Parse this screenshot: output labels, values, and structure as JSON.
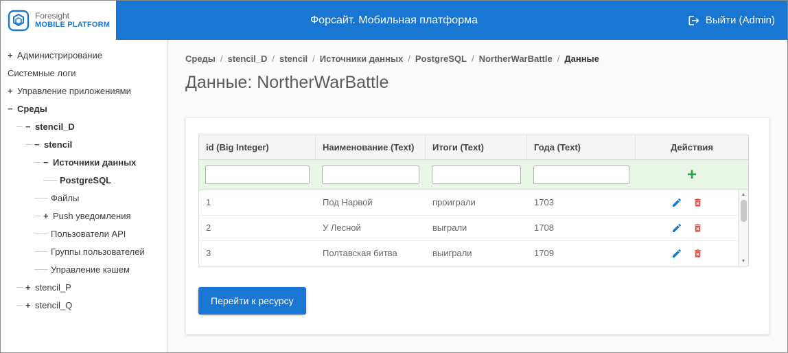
{
  "colors": {
    "primary": "#1976d2",
    "success": "#2f9e44",
    "danger": "#d9534f"
  },
  "header": {
    "logo_title": "Foresight",
    "logo_subtitle": "MOBILE PLATFORM",
    "app_title": "Форсайт. Мобильная платформа",
    "logout_label": "Выйти (Admin)"
  },
  "sidebar": {
    "items": [
      {
        "label": "Администрирование",
        "expander": "+",
        "level": 0,
        "bold": false
      },
      {
        "label": "Системные логи",
        "expander": "",
        "level": 0,
        "bold": false
      },
      {
        "label": "Управление приложениями",
        "expander": "+",
        "level": 0,
        "bold": false
      },
      {
        "label": "Среды",
        "expander": "−",
        "level": 0,
        "bold": true
      },
      {
        "label": "stencil_D",
        "expander": "−",
        "level": 1,
        "bold": true
      },
      {
        "label": "stencil",
        "expander": "−",
        "level": 2,
        "bold": true
      },
      {
        "label": "Источники данных",
        "expander": "−",
        "level": 3,
        "bold": true
      },
      {
        "label": "PostgreSQL",
        "expander": "",
        "level": 4,
        "bold": true
      },
      {
        "label": "Файлы",
        "expander": "",
        "level": 3,
        "bold": false
      },
      {
        "label": "Push уведомления",
        "expander": "+",
        "level": 3,
        "bold": false
      },
      {
        "label": "Пользователи API",
        "expander": "",
        "level": 3,
        "bold": false
      },
      {
        "label": "Группы пользователей",
        "expander": "",
        "level": 3,
        "bold": false
      },
      {
        "label": "Управление кэшем",
        "expander": "",
        "level": 3,
        "bold": false
      },
      {
        "label": "stencil_P",
        "expander": "+",
        "level": 1,
        "bold": false
      },
      {
        "label": "stencil_Q",
        "expander": "+",
        "level": 1,
        "bold": false
      }
    ]
  },
  "main": {
    "breadcrumb": [
      "Среды",
      "stencil_D",
      "stencil",
      "Источники данных",
      "PostgreSQL",
      "NortherWarBattle",
      "Данные"
    ],
    "page_title": "Данные: NortherWarBattle",
    "table": {
      "columns": [
        "id (Big Integer)",
        "Наименование (Text)",
        "Итоги (Text)",
        "Года (Text)",
        "Действия"
      ],
      "filter_inputs": [
        "",
        "",
        "",
        ""
      ],
      "add_label": "+",
      "rows": [
        [
          "1",
          "Под Нарвой",
          "проиграли",
          "1703"
        ],
        [
          "2",
          "У Лесной",
          "выграли",
          "1708"
        ],
        [
          "3",
          "Полтавская битва",
          "выиграли",
          "1709"
        ]
      ]
    },
    "resource_button_label": "Перейти к ресурсу"
  }
}
